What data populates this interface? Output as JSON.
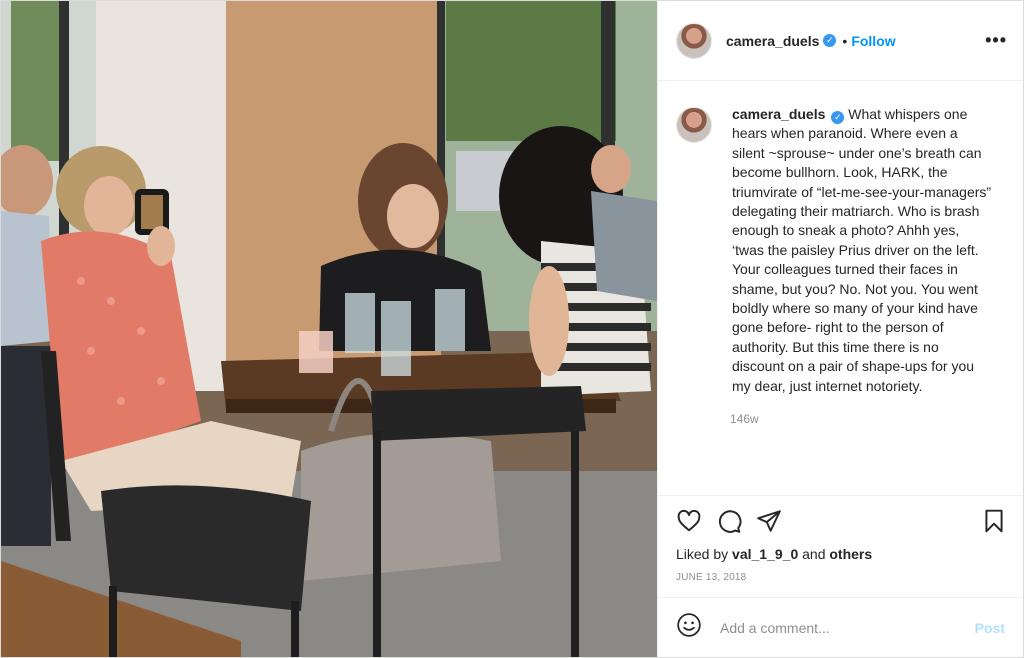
{
  "header": {
    "username": "camera_duels",
    "separator": "•",
    "follow_label": "Follow",
    "more_label": "•••"
  },
  "caption": {
    "username": "camera_duels",
    "text": "What whispers one hears when paranoid. Where even a silent ~sprouse~ under one’s breath can become bullhorn. Look, HARK, the triumvirate of “let-me-see-your-managers” delegating their matriarch. Who is brash enough to sneak a photo? Ahhh yes, ‘twas the paisley Prius driver on the left. Your colleagues turned their faces in shame, but you? No. Not you. You went boldly where so many of your kind have gone before- right to the person of authority. But this time there is no discount on a pair of shape-ups for you my dear, just internet notoriety.",
    "time_ago": "146w"
  },
  "actions": {
    "icons": [
      "heart-icon",
      "comment-icon",
      "share-icon",
      "bookmark-icon"
    ],
    "liked_by_prefix": "Liked by",
    "liked_by_user": "val_1_9_0",
    "liked_by_conj": "and",
    "liked_by_others": "others",
    "date": "JUNE 13, 2018"
  },
  "add_comment": {
    "placeholder": "Add a comment...",
    "post_label": "Post",
    "emoji_icon": "smiley-icon"
  },
  "colors": {
    "accent": "#0095f6",
    "verified": "#3897f0",
    "post_disabled": "#b2dffc",
    "muted": "#8e8e8e"
  }
}
